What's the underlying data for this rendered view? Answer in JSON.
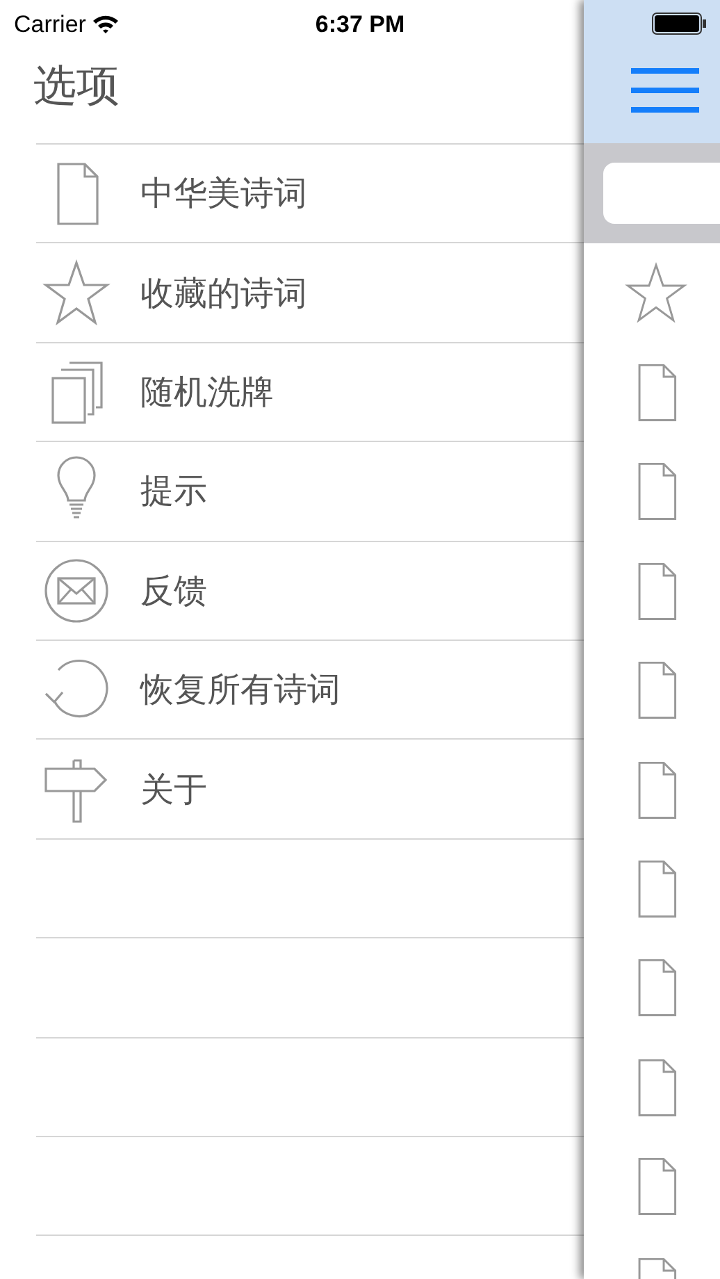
{
  "status_bar": {
    "carrier": "Carrier",
    "time": "6:37 PM"
  },
  "menu": {
    "title": "选项",
    "items": [
      {
        "label": "中华美诗词",
        "kind": "document"
      },
      {
        "label": "收藏的诗词",
        "kind": "star"
      },
      {
        "label": "随机洗牌",
        "kind": "cards"
      },
      {
        "label": "提示",
        "kind": "bulb"
      },
      {
        "label": "反馈",
        "kind": "mail"
      },
      {
        "label": "恢复所有诗词",
        "kind": "restore"
      },
      {
        "label": "关于",
        "kind": "signpost"
      }
    ]
  },
  "side_panel": {
    "rows": [
      {
        "kind": "star"
      },
      {
        "kind": "document"
      },
      {
        "kind": "document"
      },
      {
        "kind": "document"
      },
      {
        "kind": "document"
      },
      {
        "kind": "document"
      },
      {
        "kind": "document"
      },
      {
        "kind": "document"
      },
      {
        "kind": "document"
      },
      {
        "kind": "document"
      },
      {
        "kind": "document"
      }
    ]
  }
}
